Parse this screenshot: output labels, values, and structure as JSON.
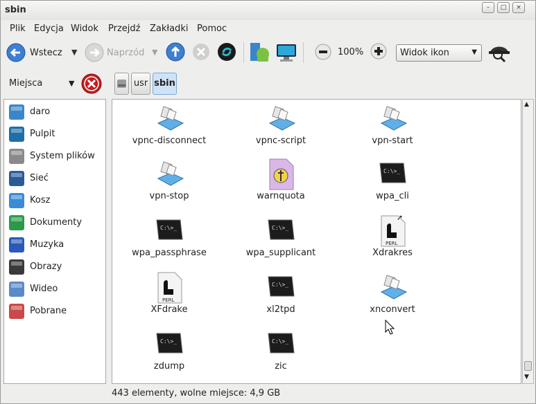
{
  "window": {
    "title": "sbin",
    "btn_minimize": "–",
    "btn_maximize": "□",
    "btn_close": "×"
  },
  "menu": [
    "Plik",
    "Edycja",
    "Widok",
    "Przejdź",
    "Zakładki",
    "Pomoc"
  ],
  "toolbar": {
    "back": "Wstecz",
    "forward": "Naprzód",
    "zoom": "100%",
    "view_mode": "Widok ikon",
    "dropdown_arrow": "▼"
  },
  "location": {
    "places_label": "Miejsca",
    "crumbs": [
      "usr",
      "sbin"
    ]
  },
  "sidebar": [
    {
      "label": "daro",
      "icon": "home-icon"
    },
    {
      "label": "Pulpit",
      "icon": "desktop-icon"
    },
    {
      "label": "System plików",
      "icon": "drive-icon"
    },
    {
      "label": "Sieć",
      "icon": "network-icon"
    },
    {
      "label": "Kosz",
      "icon": "trash-icon"
    },
    {
      "label": "Dokumenty",
      "icon": "documents-folder-icon"
    },
    {
      "label": "Muzyka",
      "icon": "music-folder-icon"
    },
    {
      "label": "Obrazy",
      "icon": "pictures-folder-icon"
    },
    {
      "label": "Wideo",
      "icon": "video-folder-icon"
    },
    {
      "label": "Pobrane",
      "icon": "downloads-folder-icon"
    }
  ],
  "files": [
    {
      "name": "vpnc-disconnect",
      "type": "script"
    },
    {
      "name": "vpnc-script",
      "type": "script"
    },
    {
      "name": "vpn-start",
      "type": "script"
    },
    {
      "name": "vpn-stop",
      "type": "script"
    },
    {
      "name": "warnquota",
      "type": "binary"
    },
    {
      "name": "wpa_cli",
      "type": "terminal"
    },
    {
      "name": "wpa_passphrase",
      "type": "terminal"
    },
    {
      "name": "wpa_supplicant",
      "type": "terminal"
    },
    {
      "name": "Xdrakres",
      "type": "perl"
    },
    {
      "name": "XFdrake",
      "type": "perl"
    },
    {
      "name": "xl2tpd",
      "type": "terminal"
    },
    {
      "name": "xnconvert",
      "type": "script"
    },
    {
      "name": "zdump",
      "type": "terminal"
    },
    {
      "name": "zic",
      "type": "terminal"
    }
  ],
  "term_prompt": "C:\\>_",
  "perl_text": "PERL",
  "status": "443 elementy, wolne miejsce: 4,9 GB",
  "colors": {
    "accent": "#3f7fd2",
    "selected_crumb": "#cfe3f7"
  }
}
